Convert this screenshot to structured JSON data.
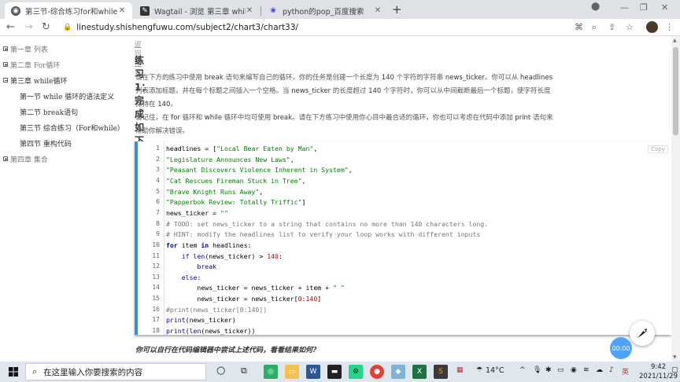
{
  "browser": {
    "tabs": [
      {
        "title": "第三节-综合练习for和while",
        "favicon": "site-icon"
      },
      {
        "title": "Wagtail - 浏览 第三章 while循环",
        "favicon": "wagtail-icon"
      },
      {
        "title": "python的pop_百度搜索",
        "favicon": "baidu-icon"
      }
    ],
    "url": "linestudy.shishengfuwu.com/subject2/chart3/chart33/"
  },
  "sidebar": {
    "items": [
      {
        "label": "第一章 列表",
        "state": "collapsed"
      },
      {
        "label": "第二章 For循环",
        "state": "collapsed"
      },
      {
        "label": "第三章 while循环",
        "state": "expanded"
      },
      {
        "label": "第一节 while 循环的语法定义",
        "state": "child"
      },
      {
        "label": "第二节 break语句",
        "state": "child"
      },
      {
        "label": "第三节 综合练习（For和while）",
        "state": "child"
      },
      {
        "label": "第四节 重构代码",
        "state": "child"
      },
      {
        "label": "第四章 集合",
        "state": "collapsed"
      }
    ]
  },
  "main": {
    "back_link": "返回本章",
    "title": "练习1：完成如下的任务",
    "para1": {
      "a": "请在下方的练习中使用 ",
      "b": "break",
      "c": " 语句来编写自己的循环。你的任务是创建一个长度为 ",
      "d": "140",
      "e": " 个字符的字符串 ",
      "f": "news_ticker",
      "g": "。你可以从 ",
      "h": "headlines",
      "line2a": "列表添加标题，并在每个标题之间插入一个空格。当 ",
      "line2b": "news_ticker",
      "line2c": " 的长度超过 ",
      "line2d": "140",
      "line2e": " 个字符时，你可以从中间截断最后一个标题，使字符长度",
      "line3a": "保持在 ",
      "line3b": "140",
      "line3c": "。"
    },
    "para2": {
      "a": "请记住，在 ",
      "b": "for",
      "c": " 循环和 ",
      "d": "while",
      "e": " 循环中均可使用 ",
      "f": "break",
      "g": "。请在下方练习中使用你心目中最合适的循环，你也可以考虑在代码中添加 ",
      "h": "print",
      "i": " 语句来",
      "line2": "帮助你解决错误。"
    },
    "copy_label": "Copy",
    "code_lines": [
      [
        {
          "t": "headlines = [",
          "c": ""
        },
        {
          "t": "\"Local Bear Eaten by Man\"",
          "c": "s"
        },
        {
          "t": ",",
          "c": ""
        }
      ],
      [
        {
          "t": "\"Legislature Announces New Laws\"",
          "c": "s"
        },
        {
          "t": ",",
          "c": ""
        }
      ],
      [
        {
          "t": "\"Peasant Discovers Violence Inherent in System\"",
          "c": "s"
        },
        {
          "t": ",",
          "c": ""
        }
      ],
      [
        {
          "t": "\"Cat Rescues Fireman Stuck in Tree\"",
          "c": "s"
        },
        {
          "t": ",",
          "c": ""
        }
      ],
      [
        {
          "t": "\"Brave Knight Runs Away\"",
          "c": "s"
        },
        {
          "t": ",",
          "c": ""
        }
      ],
      [
        {
          "t": "\"Papperbok Review: Totally Triffic\"",
          "c": "s"
        },
        {
          "t": "]",
          "c": ""
        }
      ],
      [
        {
          "t": "news_ticker = ",
          "c": ""
        },
        {
          "t": "\"\"",
          "c": "s"
        }
      ],
      [
        {
          "t": "# TODO: set news_ticker to a string that contains no more than 140 characters long.",
          "c": "c"
        }
      ],
      [
        {
          "t": "# HINT: modify the headlines list to verify your loop works with different inputs",
          "c": "c"
        }
      ],
      [
        {
          "t": "for",
          "c": "k"
        },
        {
          "t": " item ",
          "c": ""
        },
        {
          "t": "in",
          "c": "k"
        },
        {
          "t": " headlines:",
          "c": ""
        }
      ],
      [
        {
          "t": "    ",
          "c": ""
        },
        {
          "t": "if",
          "c": "kn"
        },
        {
          "t": " ",
          "c": ""
        },
        {
          "t": "len",
          "c": "kn"
        },
        {
          "t": "(news_ticker) > ",
          "c": ""
        },
        {
          "t": "140",
          "c": "n"
        },
        {
          "t": ":",
          "c": ""
        }
      ],
      [
        {
          "t": "        ",
          "c": ""
        },
        {
          "t": "break",
          "c": "kn"
        }
      ],
      [
        {
          "t": "    ",
          "c": ""
        },
        {
          "t": "else",
          "c": "kn"
        },
        {
          "t": ":",
          "c": ""
        }
      ],
      [
        {
          "t": "        news_ticker = news_ticker + item + ",
          "c": ""
        },
        {
          "t": "\" \"",
          "c": "s"
        }
      ],
      [
        {
          "t": "        news_ticker = news_ticker[",
          "c": ""
        },
        {
          "t": "0",
          "c": "n"
        },
        {
          "t": ":",
          "c": ""
        },
        {
          "t": "140",
          "c": "n"
        },
        {
          "t": "]",
          "c": ""
        }
      ],
      [
        {
          "t": "#print(news_ticker[0:140])",
          "c": "c"
        }
      ],
      [
        {
          "t": "print",
          "c": "kn"
        },
        {
          "t": "(news_ticker)",
          "c": ""
        }
      ],
      [
        {
          "t": "print",
          "c": "kn"
        },
        {
          "t": "(",
          "c": ""
        },
        {
          "t": "len",
          "c": "kn"
        },
        {
          "t": "(news_ticker))",
          "c": ""
        }
      ]
    ],
    "bottom_question": "你可以自行在代码编辑器中尝试上述代码，看看结果如何?"
  },
  "widgets": {
    "timer": "00:00"
  },
  "taskbar": {
    "search_placeholder": "在这里输入你要搜索的内容",
    "weather": "14°C",
    "time": "9:42",
    "date": "2021/11/29",
    "ime": "英"
  }
}
